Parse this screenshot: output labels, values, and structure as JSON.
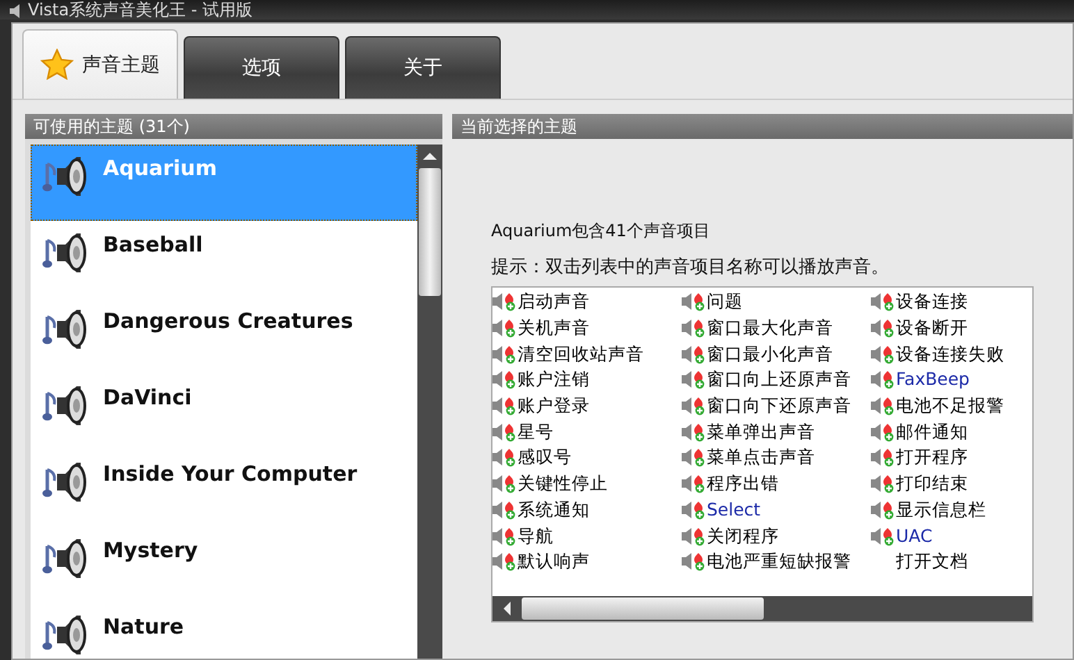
{
  "window": {
    "title": "Vista系统声音美化王 - 试用版"
  },
  "tabs": [
    {
      "label": "声音主题",
      "selected": true,
      "icon": true
    },
    {
      "label": "选项",
      "selected": false,
      "icon": false
    },
    {
      "label": "关于",
      "selected": false,
      "icon": false
    }
  ],
  "themes_panel": {
    "header": "可使用的主题 (31个)",
    "items": [
      {
        "name": "Aquarium",
        "selected": true
      },
      {
        "name": "Baseball",
        "selected": false
      },
      {
        "name": "Dangerous Creatures",
        "selected": false
      },
      {
        "name": "DaVinci",
        "selected": false
      },
      {
        "name": "Inside Your Computer",
        "selected": false
      },
      {
        "name": "Mystery",
        "selected": false
      },
      {
        "name": "Nature",
        "selected": false
      }
    ]
  },
  "current_panel": {
    "header": "当前选择的主题",
    "summary": "Aquarium包含41个声音项目",
    "hint": "提示：双击列表中的声音项目名称可以播放声音。",
    "sounds": [
      {
        "label": "启动声音",
        "icon": true,
        "color": "#000000"
      },
      {
        "label": "关机声音",
        "icon": true,
        "color": "#000000"
      },
      {
        "label": "清空回收站声音",
        "icon": true,
        "color": "#000000"
      },
      {
        "label": "账户注销",
        "icon": true,
        "color": "#000000"
      },
      {
        "label": "账户登录",
        "icon": true,
        "color": "#000000"
      },
      {
        "label": "星号",
        "icon": true,
        "color": "#000000"
      },
      {
        "label": "感叹号",
        "icon": true,
        "color": "#000000"
      },
      {
        "label": "关键性停止",
        "icon": true,
        "color": "#000000"
      },
      {
        "label": "系统通知",
        "icon": true,
        "color": "#000000"
      },
      {
        "label": "导航",
        "icon": true,
        "color": "#000000"
      },
      {
        "label": "默认响声",
        "icon": true,
        "color": "#000000"
      },
      {
        "label": "问题",
        "icon": true,
        "color": "#000000"
      },
      {
        "label": "窗口最大化声音",
        "icon": true,
        "color": "#000000"
      },
      {
        "label": "窗口最小化声音",
        "icon": true,
        "color": "#000000"
      },
      {
        "label": "窗口向上还原声音",
        "icon": true,
        "color": "#000000"
      },
      {
        "label": "窗口向下还原声音",
        "icon": true,
        "color": "#000000"
      },
      {
        "label": "菜单弹出声音",
        "icon": true,
        "color": "#000000"
      },
      {
        "label": "菜单点击声音",
        "icon": true,
        "color": "#000000"
      },
      {
        "label": "程序出错",
        "icon": true,
        "color": "#000000"
      },
      {
        "label": "Select",
        "icon": true,
        "color": "#1c2aa8"
      },
      {
        "label": "关闭程序",
        "icon": true,
        "color": "#000000"
      },
      {
        "label": "电池严重短缺报警",
        "icon": true,
        "color": "#000000"
      },
      {
        "label": "设备连接",
        "icon": true,
        "color": "#000000"
      },
      {
        "label": "设备断开",
        "icon": true,
        "color": "#000000"
      },
      {
        "label": "设备连接失败",
        "icon": true,
        "color": "#000000"
      },
      {
        "label": "FaxBeep",
        "icon": true,
        "color": "#1c2aa8"
      },
      {
        "label": "电池不足报警",
        "icon": true,
        "color": "#000000"
      },
      {
        "label": "邮件通知",
        "icon": true,
        "color": "#000000"
      },
      {
        "label": "打开程序",
        "icon": true,
        "color": "#000000"
      },
      {
        "label": "打印结束",
        "icon": true,
        "color": "#000000"
      },
      {
        "label": "显示信息栏",
        "icon": true,
        "color": "#000000"
      },
      {
        "label": "UAC",
        "icon": true,
        "color": "#1c2aa8"
      },
      {
        "label": "打开文档",
        "icon": false,
        "color": "#000000"
      }
    ]
  }
}
